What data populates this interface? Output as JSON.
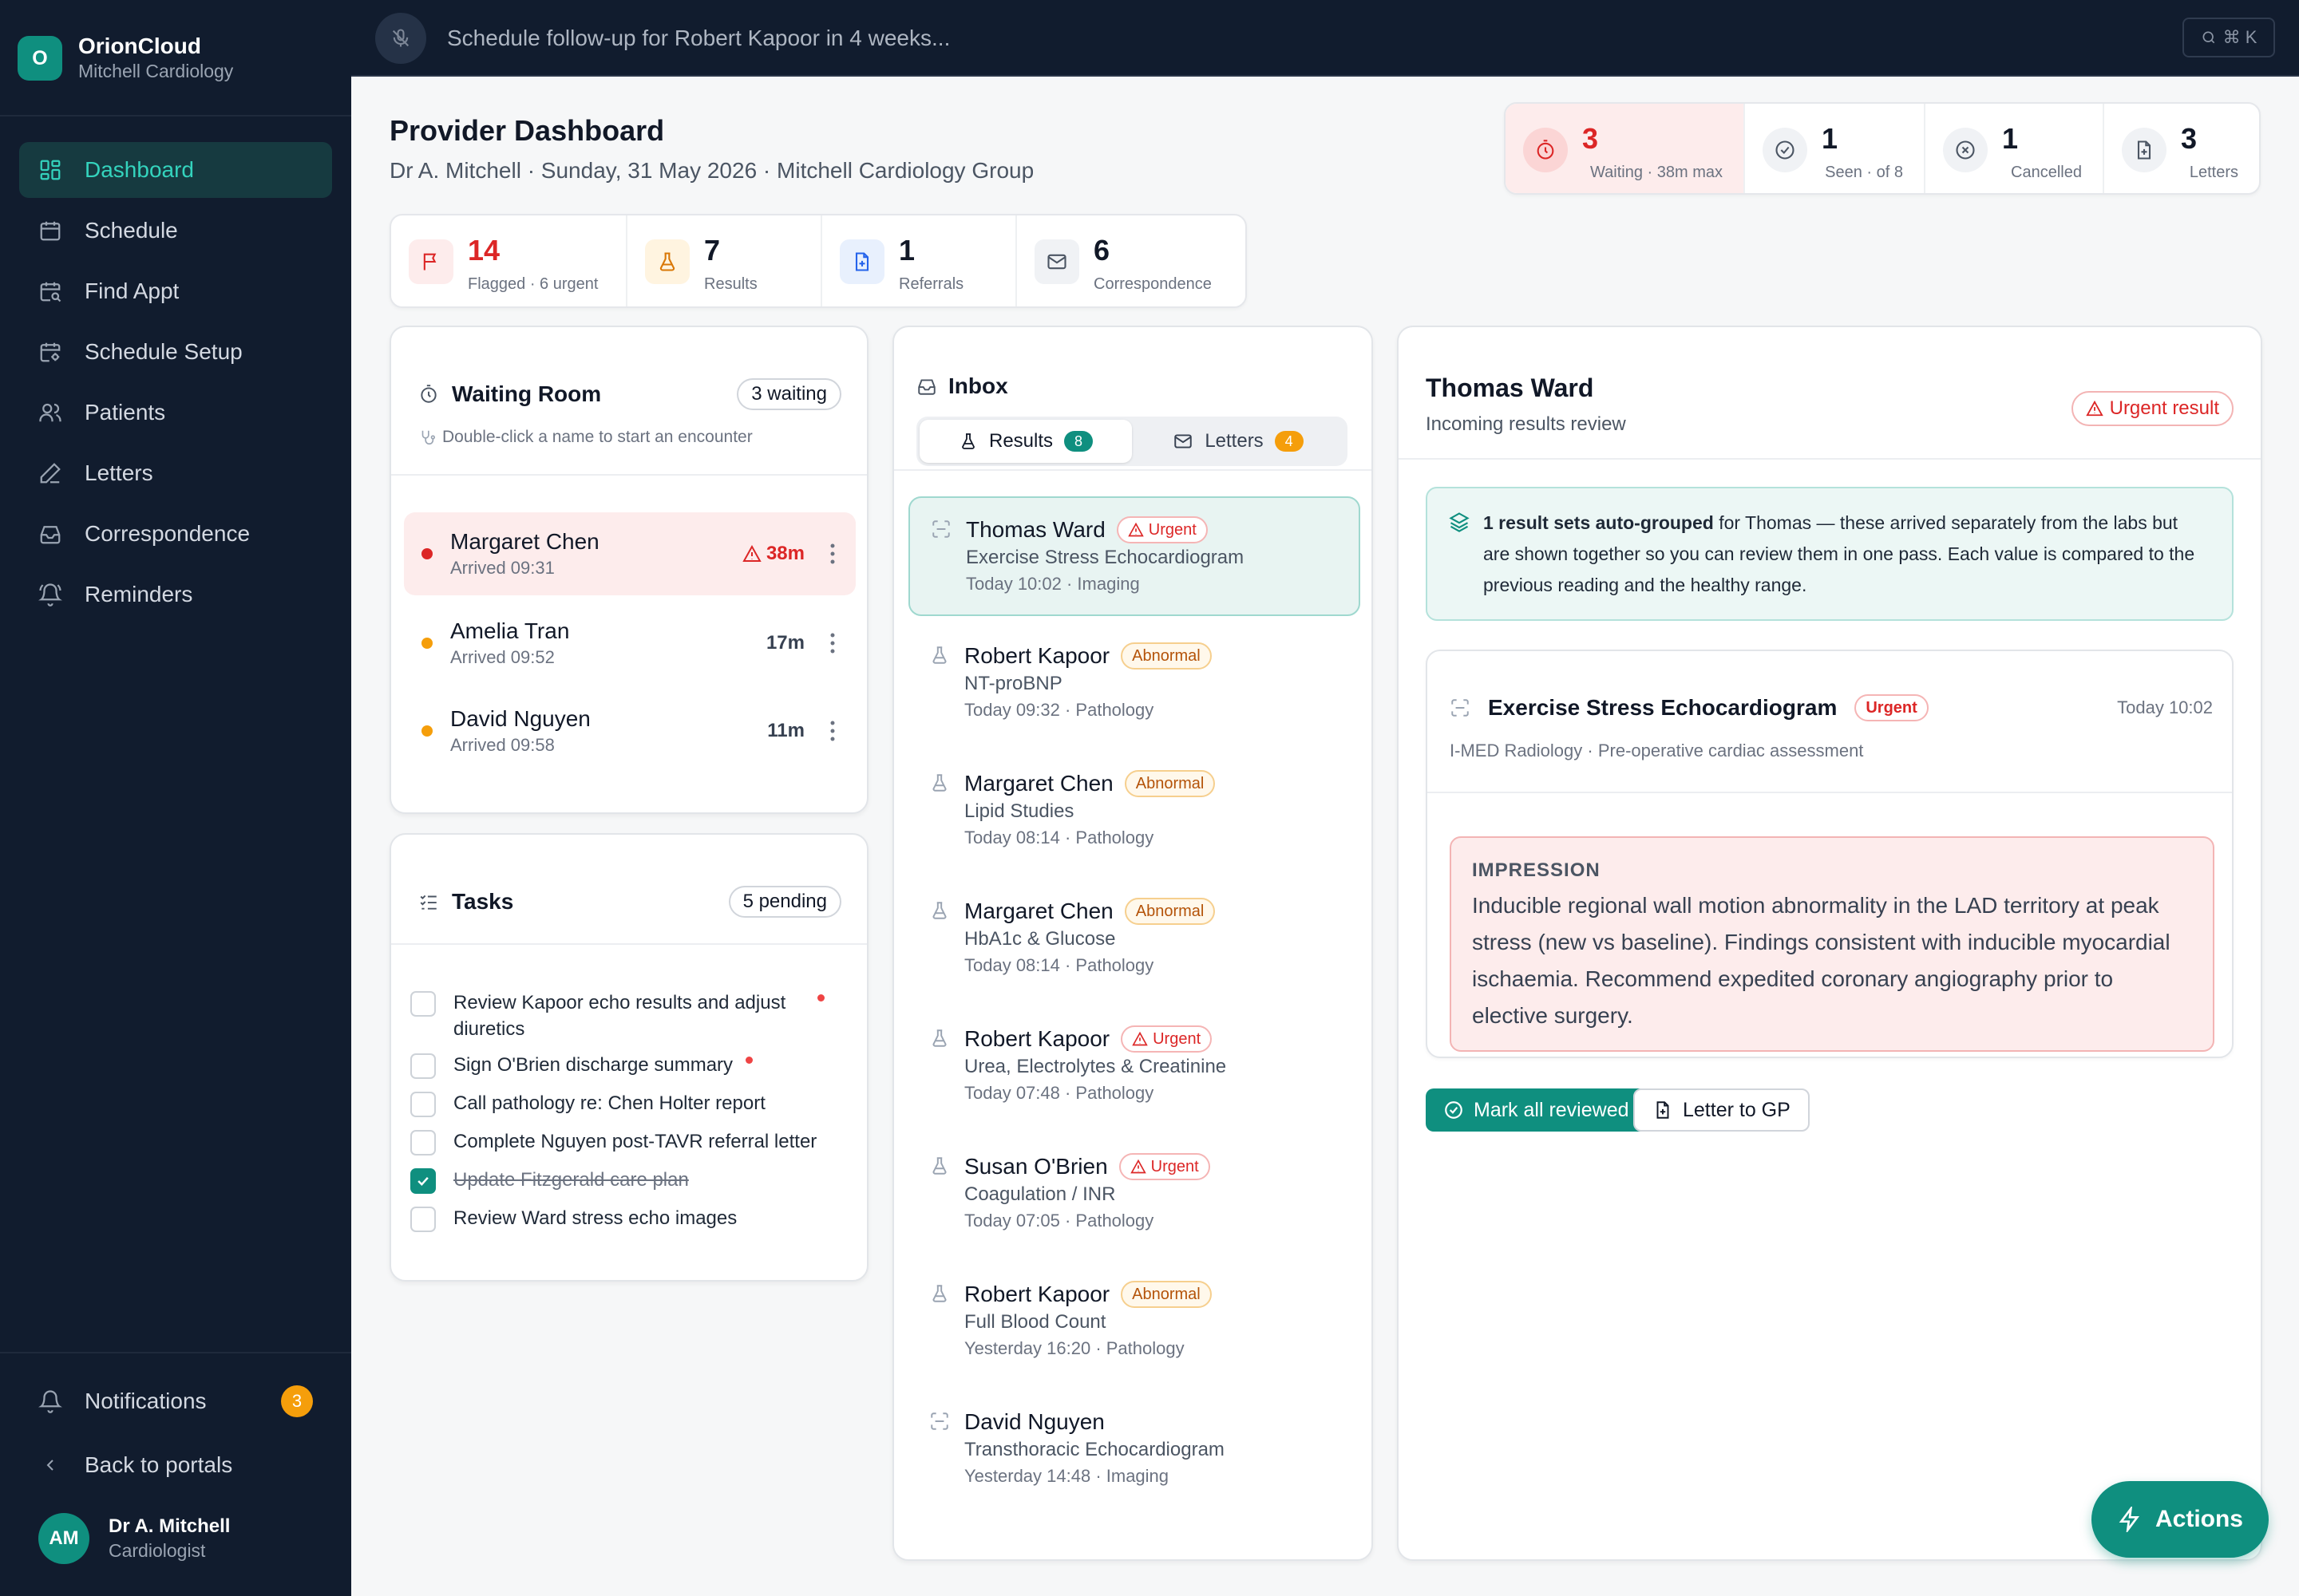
{
  "brand": {
    "logo_letter": "O",
    "name": "OrionCloud",
    "practice": "Mitchell Cardiology"
  },
  "nav": [
    {
      "label": "Dashboard",
      "icon": "dashboard-icon",
      "active": true
    },
    {
      "label": "Schedule",
      "icon": "calendar-icon"
    },
    {
      "label": "Find Appt",
      "icon": "calendar-search-icon"
    },
    {
      "label": "Schedule Setup",
      "icon": "calendar-gear-icon"
    },
    {
      "label": "Patients",
      "icon": "users-icon"
    },
    {
      "label": "Letters",
      "icon": "pen-icon"
    },
    {
      "label": "Correspondence",
      "icon": "inbox-icon"
    },
    {
      "label": "Reminders",
      "icon": "bell-ring-icon"
    }
  ],
  "sidebar_footer": {
    "notifications_label": "Notifications",
    "notifications_count": "3",
    "back_label": "Back to portals"
  },
  "user": {
    "initials": "AM",
    "name": "Dr A. Mitchell",
    "role": "Cardiologist"
  },
  "command": {
    "placeholder": "Schedule follow-up for Robert Kapoor in 4 weeks...",
    "shortcut": "⌘ K"
  },
  "header": {
    "title": "Provider Dashboard",
    "subtitle": "Dr A. Mitchell · Sunday, 31 May 2026 · Mitchell Cardiology Group"
  },
  "top_stats": [
    {
      "value": "3",
      "label": "Waiting · 38m max",
      "icon": "timer-icon"
    },
    {
      "value": "1",
      "label": "Seen · of 8",
      "icon": "check-circle-icon"
    },
    {
      "value": "1",
      "label": "Cancelled",
      "icon": "x-circle-icon"
    },
    {
      "value": "3",
      "label": "Letters",
      "icon": "document-icon"
    }
  ],
  "inbox_stats": [
    {
      "value": "14",
      "label": "Flagged · 6 urgent",
      "icon": "flag-icon"
    },
    {
      "value": "7",
      "label": "Results",
      "icon": "flask-icon"
    },
    {
      "value": "1",
      "label": "Referrals",
      "icon": "document-plus-icon"
    },
    {
      "value": "6",
      "label": "Correspondence",
      "icon": "mail-icon"
    }
  ],
  "waiting_room": {
    "title": "Waiting Room",
    "count_label": "3 waiting",
    "hint": "Double-click a name to start an encounter",
    "patients": [
      {
        "name": "Margaret Chen",
        "arrived": "Arrived 09:31",
        "wait": "38m",
        "alert": true
      },
      {
        "name": "Amelia Tran",
        "arrived": "Arrived 09:52",
        "wait": "17m",
        "alert": false
      },
      {
        "name": "David Nguyen",
        "arrived": "Arrived 09:58",
        "wait": "11m",
        "alert": false
      }
    ]
  },
  "tasks": {
    "title": "Tasks",
    "count_label": "5 pending",
    "items": [
      {
        "text": "Review Kapoor echo results and adjust diuretics",
        "done": false,
        "priority": true
      },
      {
        "text": "Sign O'Brien discharge summary",
        "done": false,
        "priority": true
      },
      {
        "text": "Call pathology re: Chen Holter report",
        "done": false,
        "priority": false
      },
      {
        "text": "Complete Nguyen post-TAVR referral letter",
        "done": false,
        "priority": false
      },
      {
        "text": "Update Fitzgerald care plan",
        "done": true,
        "priority": false
      },
      {
        "text": "Review Ward stress echo images",
        "done": false,
        "priority": false
      }
    ]
  },
  "inbox": {
    "title": "Inbox",
    "tabs": [
      {
        "label": "Results",
        "count": "8",
        "active": true
      },
      {
        "label": "Letters",
        "count": "4",
        "active": false
      }
    ],
    "items": [
      {
        "name": "Thomas Ward",
        "tag": "Urgent",
        "test": "Exercise Stress Echocardiogram",
        "meta": "Today 10:02 · Imaging",
        "selected": true
      },
      {
        "name": "Robert Kapoor",
        "tag": "Abnormal",
        "test": "NT-proBNP",
        "meta": "Today 09:32 · Pathology"
      },
      {
        "name": "Margaret Chen",
        "tag": "Abnormal",
        "test": "Lipid Studies",
        "meta": "Today 08:14 · Pathology"
      },
      {
        "name": "Margaret Chen",
        "tag": "Abnormal",
        "test": "HbA1c & Glucose",
        "meta": "Today 08:14 · Pathology"
      },
      {
        "name": "Robert Kapoor",
        "tag": "Urgent",
        "test": "Urea, Electrolytes & Creatinine",
        "meta": "Today 07:48 · Pathology"
      },
      {
        "name": "Susan O'Brien",
        "tag": "Urgent",
        "test": "Coagulation / INR",
        "meta": "Today 07:05 · Pathology"
      },
      {
        "name": "Robert Kapoor",
        "tag": "Abnormal",
        "test": "Full Blood Count",
        "meta": "Yesterday 16:20 · Pathology"
      },
      {
        "name": "David Nguyen",
        "tag": "",
        "test": "Transthoracic Echocardiogram",
        "meta": "Yesterday 14:48 · Imaging"
      }
    ]
  },
  "review": {
    "patient": "Thomas Ward",
    "subtitle": "Incoming results review",
    "badge": "Urgent result",
    "notice_bold": "1 result sets auto-grouped",
    "notice_rest": " for Thomas — these arrived separately from the labs but are shown together so you can review them in one pass. Each value is compared to the previous reading and the healthy range.",
    "result": {
      "title": "Exercise Stress Echocardiogram",
      "tag": "Urgent",
      "time": "Today 10:02",
      "source": "I-MED Radiology · Pre-operative cardiac assessment",
      "impression_label": "IMPRESSION",
      "impression": "Inducible regional wall motion abnormality in the LAD territory at peak stress (new vs baseline). Findings consistent with inducible myocardial ischaemia. Recommend expedited coronary angiography prior to elective surgery."
    },
    "actions": {
      "primary": "Mark all reviewed",
      "secondary": "Letter to GP"
    }
  },
  "fab": {
    "label": "Actions"
  },
  "colors": {
    "accent": "#0f8f7f",
    "urgent": "#dc2626",
    "abnormal": "#b45309",
    "sidebar": "#111c2e"
  }
}
